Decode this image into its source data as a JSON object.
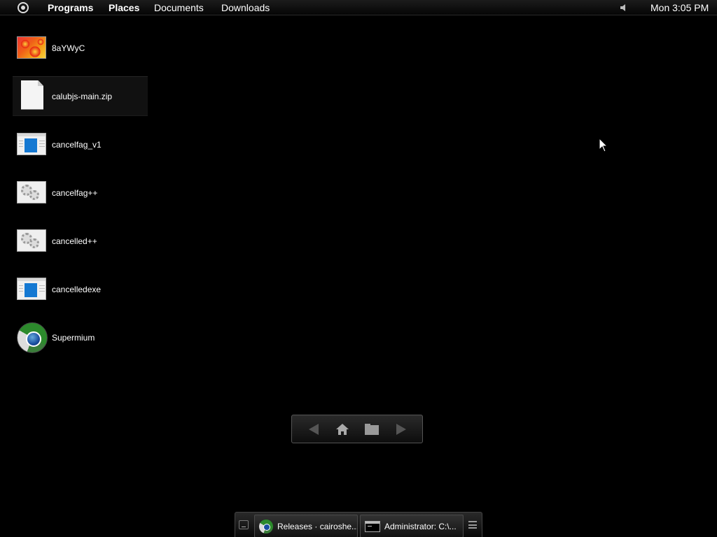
{
  "menubar": {
    "start_icon": "start-orb-icon",
    "items": [
      {
        "label": "Programs"
      },
      {
        "label": "Places"
      },
      {
        "label": "Documents"
      },
      {
        "label": "Downloads"
      }
    ],
    "volume_icon": "speaker-icon",
    "clock": "Mon 3:05 PM"
  },
  "desktop": {
    "items": [
      {
        "label": "8aYWyC",
        "icon": "image-icon"
      },
      {
        "label": "calubjs-main.zip",
        "icon": "file-icon",
        "selected": true
      },
      {
        "label": "cancelfag_v1",
        "icon": "executable-icon"
      },
      {
        "label": "cancelfag++",
        "icon": "gears-icon"
      },
      {
        "label": "cancelled++",
        "icon": "gears-icon"
      },
      {
        "label": "cancelledexe",
        "icon": "executable-icon"
      },
      {
        "label": "Supermium",
        "icon": "browser-icon"
      }
    ]
  },
  "nav_widget": {
    "buttons": [
      "back-arrow-icon",
      "home-icon",
      "folder-icon",
      "forward-arrow-icon"
    ]
  },
  "taskbar": {
    "show_desktop_icon": "show-desktop-icon",
    "tasks": [
      {
        "label": "Releases · cairoshe...",
        "icon": "browser-icon"
      },
      {
        "label": "Administrator: C:\\...",
        "icon": "terminal-icon"
      }
    ],
    "menu_icon": "hamburger-menu-icon"
  },
  "colors": {
    "background": "#000000",
    "menubar": "#111111",
    "text": "#ffffff",
    "accent_blue": "#1478d2"
  }
}
